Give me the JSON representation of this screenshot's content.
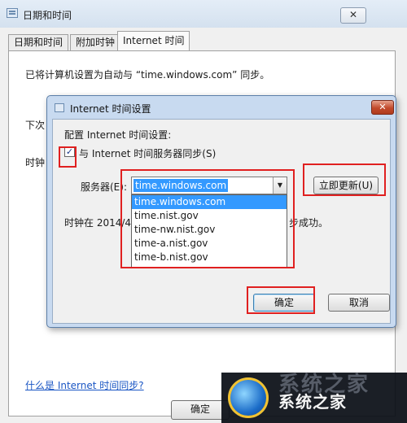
{
  "outer": {
    "title": "日期和时间",
    "close_glyph": "✕",
    "tabs": [
      {
        "label": "日期和时间"
      },
      {
        "label": "附加时钟"
      },
      {
        "label": "Internet 时间"
      }
    ],
    "sync_text": "已将计算机设置为自动与 “time.windows.com” 同步。",
    "next_text": "下次",
    "clock_text": "时钟",
    "help_link": "什么是 Internet 时间同步?",
    "ok_label": "确定"
  },
  "dialog": {
    "title": "Internet 时间设置",
    "close_glyph": "✕",
    "config_label": "配置 Internet 时间设置:",
    "checkbox_checked": true,
    "checkbox_mark": "✓",
    "sync_label": "与 Internet 时间服务器同步(S)",
    "server_label": "服务器(E):",
    "server_value": "time.windows.com",
    "update_button": "立即更新(U)",
    "server_options": [
      "time.windows.com",
      "time.nist.gov",
      "time-nw.nist.gov",
      "time-a.nist.gov",
      "time-b.nist.gov"
    ],
    "status_prefix": "时钟在 2014/4",
    "status_suffix": "步成功。",
    "ok_label": "确定",
    "cancel_label": "取消"
  },
  "watermark": {
    "text": "系统之家",
    "ghost_text": "系统之家"
  },
  "colors": {
    "highlight": "#e02020",
    "selection": "#3399ff",
    "link": "#1a56c4"
  }
}
